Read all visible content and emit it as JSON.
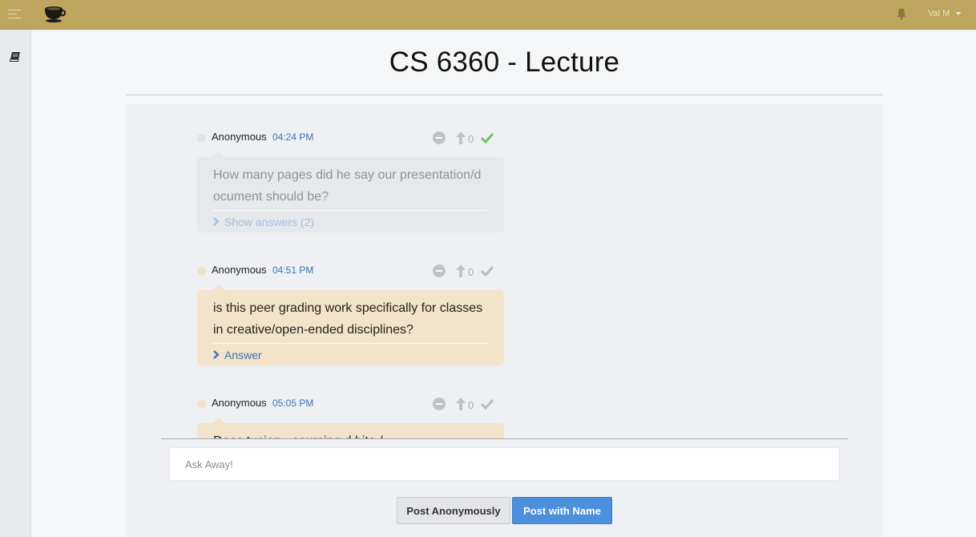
{
  "header": {
    "user_name": "Val M",
    "icons": [
      "menu-icon",
      "coffee-cup-logo",
      "bell-icon",
      "caret-down-icon"
    ]
  },
  "sidebar": {
    "icons": [
      "book-icon"
    ]
  },
  "page": {
    "title": "CS 6360 - Lecture"
  },
  "questions": [
    {
      "author": "Anonymous",
      "time": "04:24 PM",
      "votes": "0",
      "text": "How many pages did he say our presentation/document should be?",
      "link": "Show answers (2)",
      "style": "answered",
      "check_color": "#72bd68"
    },
    {
      "author": "Anonymous",
      "time": "04:51 PM",
      "votes": "0",
      "text": "is this peer grading work specifically for classes in creative/open-ended disciplines?",
      "link": "Answer",
      "style": "open",
      "check_color": "#b7babe"
    },
    {
      "author": "Anonymous",
      "time": "05:05 PM",
      "votes": "0",
      "text": "Does tucien - sourcing d bite /",
      "link": "",
      "style": "open",
      "check_color": "#b7babe"
    }
  ],
  "composer": {
    "placeholder": "Ask Away!",
    "value": "",
    "post_anonymous_label": "Post Anonymously",
    "post_name_label": "Post with Name"
  },
  "colors": {
    "topbar": "#bea55d",
    "link": "#3b74b6",
    "primary_button": "#4c8fdd",
    "answered_bubble": "#e6e8eb",
    "open_bubble": "#f3e3ca"
  }
}
